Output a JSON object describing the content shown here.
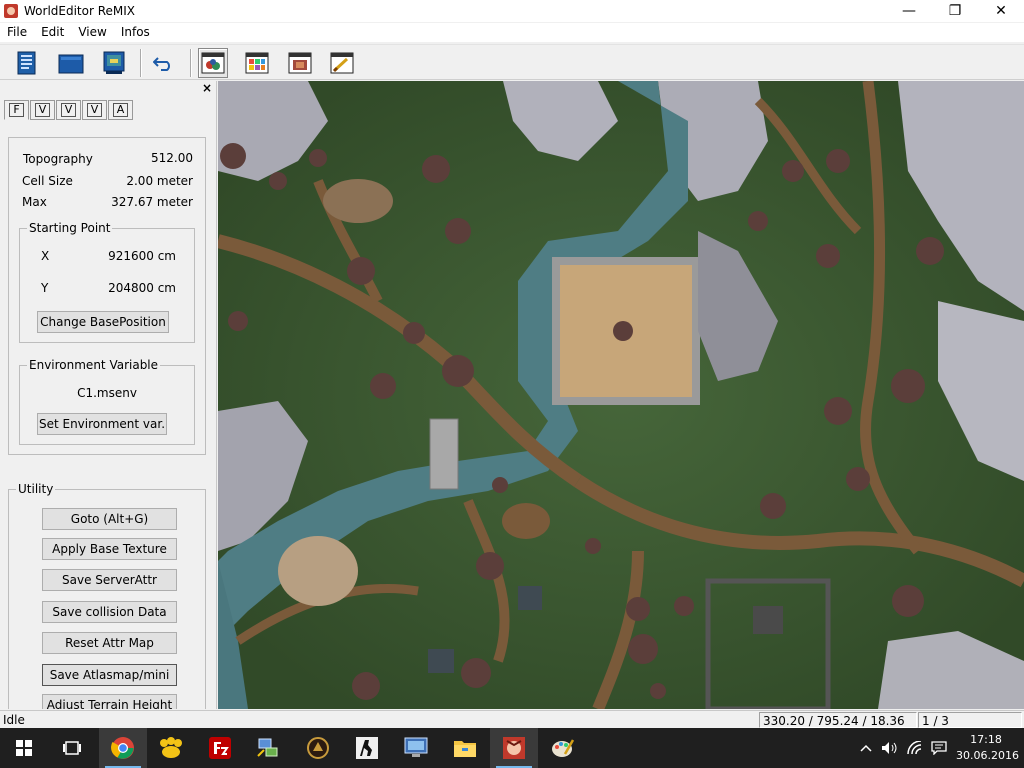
{
  "window": {
    "title": "WorldEditor ReMIX",
    "controls": {
      "minimize": "—",
      "maximize": "❐",
      "close": "✕"
    }
  },
  "menu": [
    "File",
    "Edit",
    "View",
    "Infos"
  ],
  "toolbar": {
    "buttons": [
      {
        "icon": "new-document-icon"
      },
      {
        "icon": "open-folder-icon"
      },
      {
        "icon": "save-monitor-icon"
      },
      {
        "icon": "undo-icon"
      },
      {
        "icon": "objects-window-icon"
      },
      {
        "icon": "palette-window-icon"
      },
      {
        "icon": "texture-window-icon"
      },
      {
        "icon": "brush-window-icon"
      }
    ]
  },
  "panel": {
    "close": "×",
    "tabs": [
      "F",
      "V",
      "V",
      "V",
      "A"
    ],
    "info": {
      "topography_label": "Topography",
      "topography_value": "512.00",
      "cellsize_label": "Cell Size",
      "cellsize_value": "2.00 meter",
      "max_label": "Max",
      "max_value": "327.67 meter"
    },
    "starting_point": {
      "legend": "Starting Point",
      "x_label": "X",
      "x_value": "921600 cm",
      "y_label": "Y",
      "y_value": "204800 cm",
      "button": "Change BasePosition"
    },
    "environment": {
      "legend": "Environment Variable",
      "value": "C1.msenv",
      "button": "Set Environment var."
    },
    "utility": {
      "legend": "Utility",
      "buttons": [
        "Goto (Alt+G)",
        "Apply Base Texture",
        "Save ServerAttr",
        "Save collision Data",
        "Reset Attr Map",
        "Save Atlasmap/mini",
        "Adjust Terrain Height"
      ]
    }
  },
  "status": {
    "state": "Idle",
    "coords": "330.20 / 795.24 / 18.36",
    "page": "1 / 3"
  },
  "taskbar": {
    "clock_time": "17:18",
    "clock_date": "30.06.2016",
    "apps": [
      "start-icon",
      "task-view-icon",
      "chrome-icon",
      "paw-app-icon",
      "filezilla-icon",
      "network-tool-icon",
      "metin-launcher-icon",
      "counter-strike-icon",
      "remote-desktop-icon",
      "file-explorer-icon",
      "worldeditor-icon",
      "paint-icon"
    ]
  },
  "colors": {
    "grass": "#3f5a2f",
    "dirt": "#7a5a3a",
    "water": "#4f7d84",
    "rock": "#b9b9c2",
    "taskbar": "#1f1f1f"
  }
}
